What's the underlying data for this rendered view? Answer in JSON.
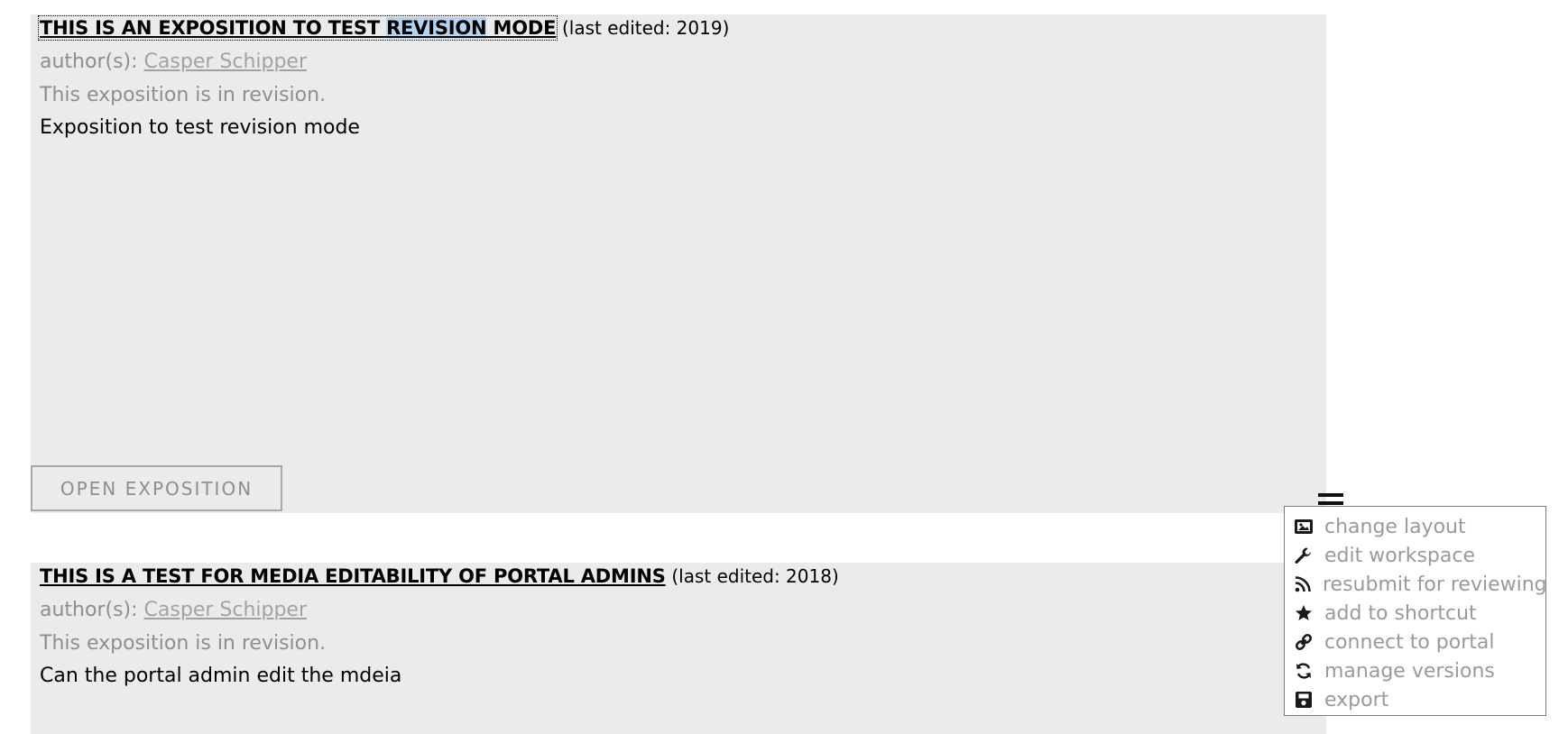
{
  "expositions": [
    {
      "title_pre": "THIS IS AN EXPOSITION TO TEST ",
      "title_highlight": "REVISION",
      "title_post": " MODE",
      "last_edited": "(last edited: 2019)",
      "author_label": "author(s):",
      "author_name": "Casper Schipper",
      "status": "This exposition is in revision.",
      "description": "Exposition to test revision mode",
      "open_button": "OPEN EXPOSITION"
    },
    {
      "title": "THIS IS A TEST FOR MEDIA EDITABILITY OF PORTAL ADMINS",
      "last_edited": "(last edited: 2018)",
      "author_label": "author(s):",
      "author_name": "Casper Schipper",
      "status": "This exposition is in revision.",
      "description": "Can the portal admin edit the mdeia"
    }
  ],
  "menu": {
    "toggle_icon": "hamburger-icon",
    "items": [
      {
        "label": "change layout",
        "icon": "image-icon"
      },
      {
        "label": "edit workspace",
        "icon": "wrench-icon"
      },
      {
        "label": "resubmit for reviewing",
        "icon": "rss-icon"
      },
      {
        "label": "add to shortcut",
        "icon": "star-icon"
      },
      {
        "label": "connect to portal",
        "icon": "link-icon"
      },
      {
        "label": "manage versions",
        "icon": "refresh-icon"
      },
      {
        "label": "export",
        "icon": "save-icon"
      }
    ]
  },
  "colors": {
    "card_background": "#ebebeb",
    "muted_text": "#8e8e8e",
    "selection": "#b5d4f0"
  }
}
